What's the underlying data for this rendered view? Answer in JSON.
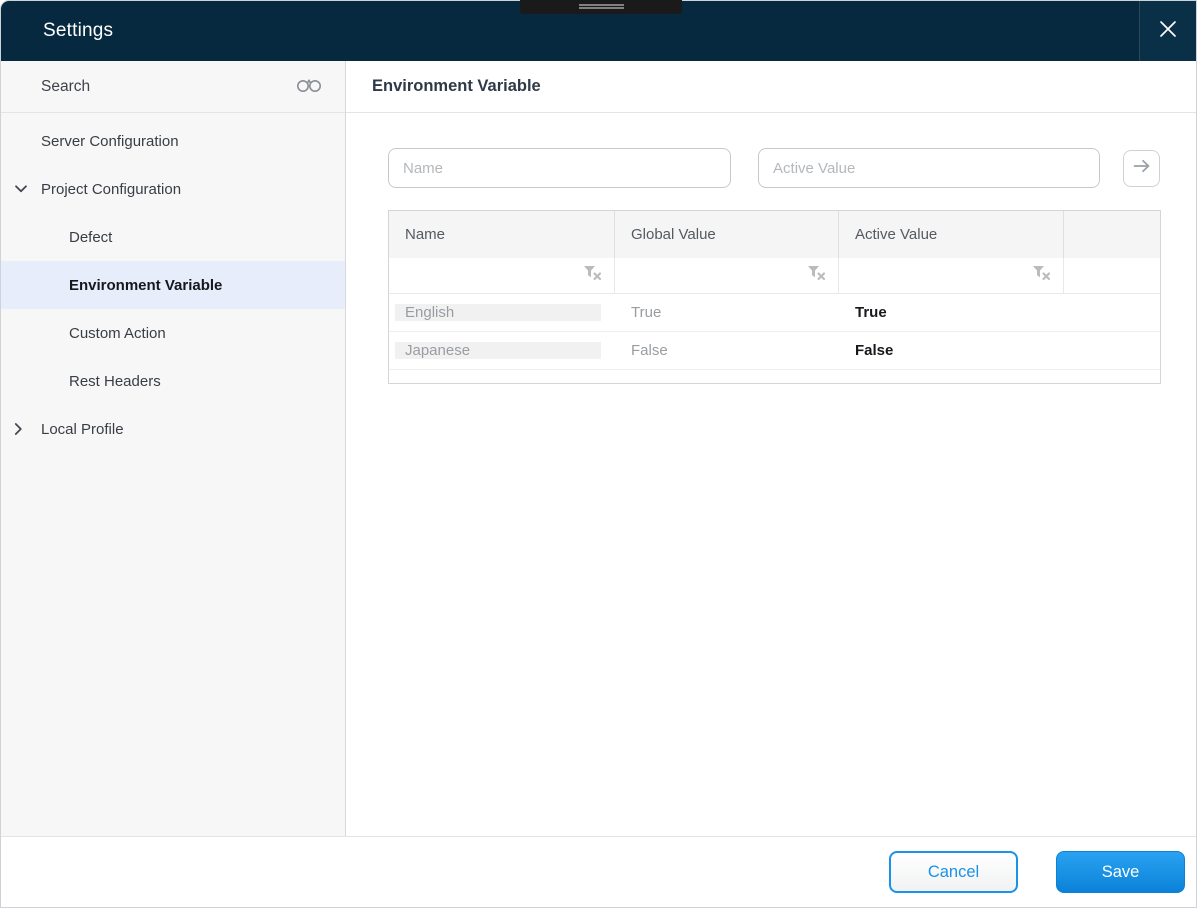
{
  "window": {
    "title": "Settings"
  },
  "sidebar": {
    "search_label": "Search",
    "items": [
      {
        "label": "Server Configuration"
      },
      {
        "label": "Project Configuration"
      },
      {
        "label": "Defect"
      },
      {
        "label": "Environment Variable"
      },
      {
        "label": "Custom Action"
      },
      {
        "label": "Rest Headers"
      },
      {
        "label": "Local Profile"
      }
    ]
  },
  "main": {
    "title": "Environment Variable",
    "inputs": {
      "name_placeholder": "Name",
      "active_value_placeholder": "Active Value"
    },
    "table": {
      "columns": [
        "Name",
        "Global Value",
        "Active Value"
      ],
      "rows": [
        {
          "name": "English",
          "global_value": "True",
          "active_value": "True"
        },
        {
          "name": "Japanese",
          "global_value": "False",
          "active_value": "False"
        }
      ]
    }
  },
  "footer": {
    "cancel_label": "Cancel",
    "save_label": "Save"
  },
  "colors": {
    "header_bg": "#062940",
    "accent_blue": "#1a92e8",
    "selected_item_bg": "#e8edfc"
  }
}
